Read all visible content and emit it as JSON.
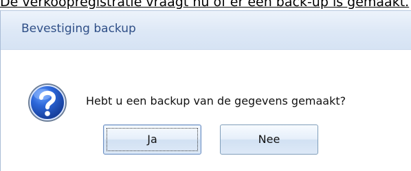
{
  "background_text": "De verkoopregistratie vraagt nu of er een back-up is gemaakt.",
  "dialog": {
    "title": "Bevestiging backup",
    "icon": "question-icon",
    "message": "Hebt u een backup van de gegevens gemaakt?",
    "buttons": {
      "yes_label": "Ja",
      "no_label": "Nee"
    }
  },
  "colors": {
    "title_text": "#2f4f87",
    "titlebar_bg": "#dde8f6",
    "icon_blue": "#1f4ea8"
  }
}
